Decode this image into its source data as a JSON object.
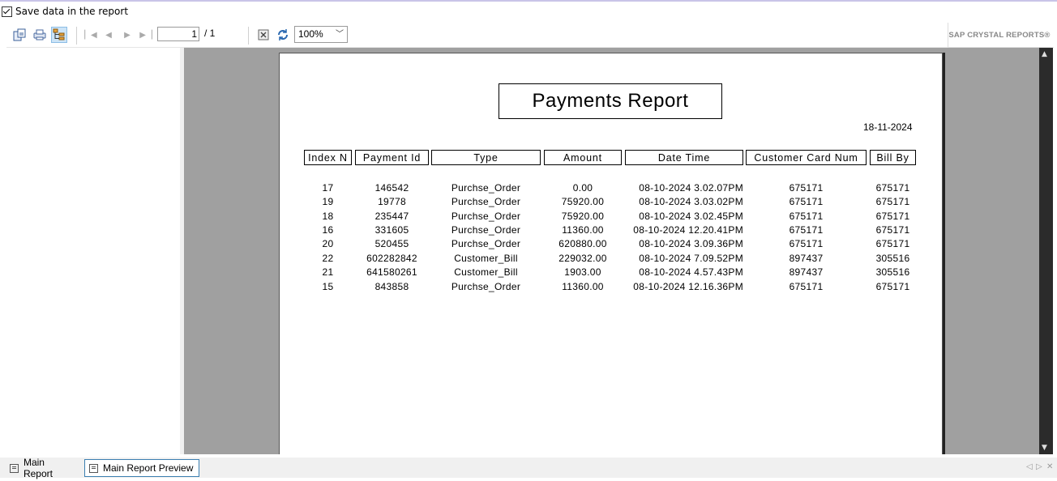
{
  "save_row": {
    "label": "Save data in the report",
    "checked": true
  },
  "toolbar": {
    "export_icon": "export-icon",
    "print_icon": "print-icon",
    "group_tree_icon": "group-tree-icon",
    "first_page_icon": "first-page-icon",
    "prev_page_icon": "prev-page-icon",
    "next_page_icon": "next-page-icon",
    "last_page_icon": "last-page-icon",
    "page_value": "1",
    "page_total": "/ 1",
    "stop_icon": "stop-icon",
    "refresh_icon": "refresh-icon",
    "zoom": "100%",
    "brand": "SAP CRYSTAL REPORTS®"
  },
  "report": {
    "title": "Payments Report",
    "date": "18-11-2024",
    "columns": [
      "Index N",
      "Payment Id",
      "Type",
      "Amount",
      "Date Time",
      "Customer Card Num",
      "Bill By"
    ],
    "rows": [
      [
        "17",
        "146542",
        "Purchse_Order",
        "0.00",
        "08-10-2024  3.02.07PM",
        "675171",
        "675171"
      ],
      [
        "19",
        "19778",
        "Purchse_Order",
        "75920.00",
        "08-10-2024  3.03.02PM",
        "675171",
        "675171"
      ],
      [
        "18",
        "235447",
        "Purchse_Order",
        "75920.00",
        "08-10-2024  3.02.45PM",
        "675171",
        "675171"
      ],
      [
        "16",
        "331605",
        "Purchse_Order",
        "11360.00",
        "08-10-2024  12.20.41PM",
        "675171",
        "675171"
      ],
      [
        "20",
        "520455",
        "Purchse_Order",
        "620880.00",
        "08-10-2024  3.09.36PM",
        "675171",
        "675171"
      ],
      [
        "22",
        "602282842",
        "Customer_Bill",
        "229032.00",
        "08-10-2024  7.09.52PM",
        "897437",
        "305516"
      ],
      [
        "21",
        "641580261",
        "Customer_Bill",
        "1903.00",
        "08-10-2024  4.57.43PM",
        "897437",
        "305516"
      ],
      [
        "15",
        "843858",
        "Purchse_Order",
        "11360.00",
        "08-10-2024  12.16.36PM",
        "675171",
        "675171"
      ]
    ]
  },
  "tabs": [
    {
      "label": "Main Report",
      "selected": false
    },
    {
      "label": "Main Report Preview",
      "selected": true
    }
  ],
  "colors": {
    "viewer_bg": "#a0a0a0",
    "tab_border": "#3c7fb1",
    "active_tool": "#cce4f7"
  }
}
